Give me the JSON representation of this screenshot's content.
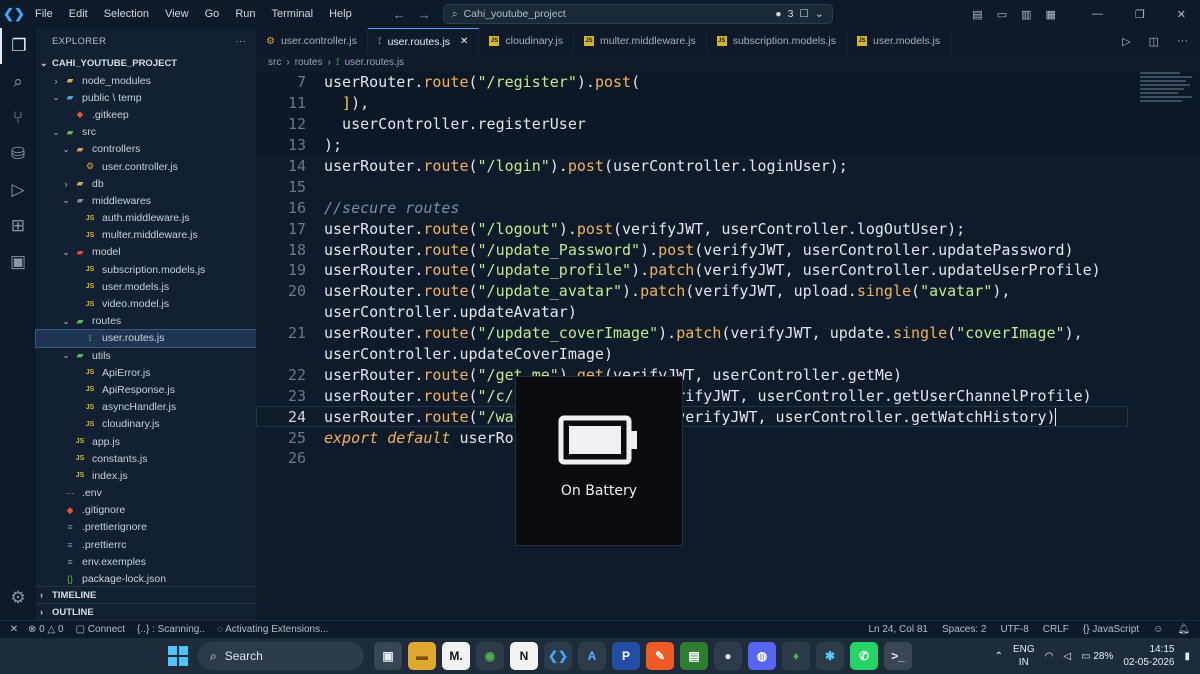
{
  "titlebar": {
    "menu": [
      "File",
      "Edit",
      "Selection",
      "View",
      "Go",
      "Run",
      "Terminal",
      "Help"
    ],
    "search_text": "Cahi_youtube_project",
    "badge_count": "3"
  },
  "sidebar": {
    "header": "EXPLORER",
    "project": "CAHI_YOUTUBE_PROJECT",
    "tree": [
      {
        "label": "node_modules",
        "depth": 1,
        "chev": "›",
        "icon": "folder",
        "color": "#d8a657"
      },
      {
        "label": "public \\ temp",
        "depth": 1,
        "chev": "⌄",
        "icon": "folder",
        "color": "#4fa3d9"
      },
      {
        "label": ".gitkeep",
        "depth": 2,
        "chev": "",
        "icon": "git",
        "color": "#e0533c"
      },
      {
        "label": "src",
        "depth": 1,
        "chev": "⌄",
        "icon": "folder",
        "color": "#5cb85c"
      },
      {
        "label": "controllers",
        "depth": 2,
        "chev": "⌄",
        "icon": "folder",
        "color": "#d8a657"
      },
      {
        "label": "user.controller.js",
        "depth": 3,
        "chev": "",
        "icon": "gear",
        "color": "#e0a03c"
      },
      {
        "label": "db",
        "depth": 2,
        "chev": "›",
        "icon": "folder",
        "color": "#d8a657"
      },
      {
        "label": "middlewares",
        "depth": 2,
        "chev": "⌄",
        "icon": "folder",
        "color": "#9b7cc2"
      },
      {
        "label": "auth.middleware.js",
        "depth": 3,
        "chev": "",
        "icon": "js",
        "color": "#d6b92a"
      },
      {
        "label": "multer.middleware.js",
        "depth": 3,
        "chev": "",
        "icon": "js",
        "color": "#d6b92a"
      },
      {
        "label": "model",
        "depth": 2,
        "chev": "⌄",
        "icon": "folder",
        "color": "#e0533c"
      },
      {
        "label": "subscription.models.js",
        "depth": 3,
        "chev": "",
        "icon": "js",
        "color": "#d6b92a"
      },
      {
        "label": "user.models.js",
        "depth": 3,
        "chev": "",
        "icon": "js",
        "color": "#d6b92a"
      },
      {
        "label": "video.model.js",
        "depth": 3,
        "chev": "",
        "icon": "js",
        "color": "#d6b92a"
      },
      {
        "label": "routes",
        "depth": 2,
        "chev": "⌄",
        "icon": "folder",
        "color": "#5cb85c"
      },
      {
        "label": "user.routes.js",
        "depth": 3,
        "chev": "",
        "icon": "route",
        "color": "#5cb85c",
        "selected": true
      },
      {
        "label": "utils",
        "depth": 2,
        "chev": "⌄",
        "icon": "folder",
        "color": "#5cb85c"
      },
      {
        "label": "ApiError.js",
        "depth": 3,
        "chev": "",
        "icon": "js",
        "color": "#d6b92a"
      },
      {
        "label": "ApiResponse.js",
        "depth": 3,
        "chev": "",
        "icon": "js",
        "color": "#d6b92a"
      },
      {
        "label": "asyncHandler.js",
        "depth": 3,
        "chev": "",
        "icon": "js",
        "color": "#d6b92a"
      },
      {
        "label": "cloudinary.js",
        "depth": 3,
        "chev": "",
        "icon": "js",
        "color": "#d6b92a"
      },
      {
        "label": "app.js",
        "depth": 2,
        "chev": "",
        "icon": "js",
        "color": "#d6b92a"
      },
      {
        "label": "constants.js",
        "depth": 2,
        "chev": "",
        "icon": "js",
        "color": "#d6b92a"
      },
      {
        "label": "index.js",
        "depth": 2,
        "chev": "",
        "icon": "js",
        "color": "#d6b92a"
      },
      {
        "label": ".env",
        "depth": 1,
        "chev": "",
        "icon": "env",
        "color": "#d8a657"
      },
      {
        "label": ".gitignore",
        "depth": 1,
        "chev": "",
        "icon": "git",
        "color": "#e0533c"
      },
      {
        "label": ".prettierignore",
        "depth": 1,
        "chev": "",
        "icon": "prettier",
        "color": "#5a9bcf"
      },
      {
        "label": ".prettierrc",
        "depth": 1,
        "chev": "",
        "icon": "prettier",
        "color": "#5a9bcf"
      },
      {
        "label": "env.exemples",
        "depth": 1,
        "chev": "",
        "icon": "file",
        "color": "#8a94a3"
      },
      {
        "label": "package-lock.json",
        "depth": 1,
        "chev": "",
        "icon": "json",
        "color": "#5cb85c"
      }
    ],
    "timeline": "TIMELINE",
    "outline": "OUTLINE"
  },
  "tabs": [
    {
      "label": "user.controller.js",
      "icon": "gear",
      "active": false
    },
    {
      "label": "user.routes.js",
      "icon": "route",
      "active": true
    },
    {
      "label": "cloudinary.js",
      "icon": "js",
      "active": false
    },
    {
      "label": "multer.middleware.js",
      "icon": "js",
      "active": false
    },
    {
      "label": "subscription.models.js",
      "icon": "js",
      "active": false
    },
    {
      "label": "user.models.js",
      "icon": "js",
      "active": false
    }
  ],
  "breadcrumb": [
    "src",
    "routes",
    "user.routes.js"
  ],
  "code_lines": [
    {
      "n": "7",
      "sticky": true,
      "tokens": [
        [
          "userRouter",
          "var"
        ],
        [
          ".",
          ""
        ],
        [
          "route",
          "meth"
        ],
        [
          "(",
          ""
        ],
        [
          "\"/register\"",
          "str"
        ],
        [
          ").",
          ""
        ],
        [
          "post",
          "meth"
        ],
        [
          "(",
          ""
        ]
      ]
    },
    {
      "n": "11",
      "sticky": true,
      "tokens": [
        [
          "  ]",
          "br"
        ],
        [
          "),",
          ""
        ]
      ]
    },
    {
      "n": "12",
      "sticky": true,
      "tokens": [
        [
          "  userController.registerUser",
          ""
        ]
      ]
    },
    {
      "n": "13",
      "sticky": true,
      "tokens": [
        [
          ");",
          ""
        ]
      ]
    },
    {
      "n": "14",
      "tokens": [
        [
          "userRouter",
          "var"
        ],
        [
          ".",
          ""
        ],
        [
          "route",
          "meth"
        ],
        [
          "(",
          ""
        ],
        [
          "\"/login\"",
          "str"
        ],
        [
          ").",
          ""
        ],
        [
          "post",
          "meth"
        ],
        [
          "(userController.loginUser);",
          ""
        ]
      ]
    },
    {
      "n": "15",
      "tokens": []
    },
    {
      "n": "16",
      "tokens": [
        [
          "//secure routes",
          "cmt"
        ]
      ]
    },
    {
      "n": "17",
      "tokens": [
        [
          "userRouter",
          "var"
        ],
        [
          ".",
          ""
        ],
        [
          "route",
          "meth"
        ],
        [
          "(",
          ""
        ],
        [
          "\"/logout\"",
          "str"
        ],
        [
          ").",
          ""
        ],
        [
          "post",
          "meth"
        ],
        [
          "(verifyJWT, userController.logOutUser);",
          ""
        ]
      ]
    },
    {
      "n": "18",
      "tokens": [
        [
          "userRouter",
          "var"
        ],
        [
          ".",
          ""
        ],
        [
          "route",
          "meth"
        ],
        [
          "(",
          ""
        ],
        [
          "\"/update_Password\"",
          "str"
        ],
        [
          ").",
          ""
        ],
        [
          "post",
          "meth"
        ],
        [
          "(verifyJWT, userController.updatePassword)",
          ""
        ]
      ]
    },
    {
      "n": "19",
      "tokens": [
        [
          "userRouter",
          "var"
        ],
        [
          ".",
          ""
        ],
        [
          "route",
          "meth"
        ],
        [
          "(",
          ""
        ],
        [
          "\"/update_profile\"",
          "str"
        ],
        [
          ").",
          ""
        ],
        [
          "patch",
          "meth"
        ],
        [
          "(verifyJWT, userController.updateUserProfile)",
          ""
        ]
      ]
    },
    {
      "n": "20",
      "tokens": [
        [
          "userRouter",
          "var"
        ],
        [
          ".",
          ""
        ],
        [
          "route",
          "meth"
        ],
        [
          "(",
          ""
        ],
        [
          "\"/update_avatar\"",
          "str"
        ],
        [
          ").",
          ""
        ],
        [
          "patch",
          "meth"
        ],
        [
          "(verifyJWT, upload.",
          ""
        ],
        [
          "single",
          "meth"
        ],
        [
          "(",
          ""
        ],
        [
          "\"avatar\"",
          "str"
        ],
        [
          "),",
          ""
        ]
      ]
    },
    {
      "n": "",
      "tokens": [
        [
          "userController.updateAvatar)",
          ""
        ]
      ]
    },
    {
      "n": "21",
      "tokens": [
        [
          "userRouter",
          "var"
        ],
        [
          ".",
          ""
        ],
        [
          "route",
          "meth"
        ],
        [
          "(",
          ""
        ],
        [
          "\"/update_coverImage\"",
          "str"
        ],
        [
          ").",
          ""
        ],
        [
          "patch",
          "meth"
        ],
        [
          "(verifyJWT, update.",
          ""
        ],
        [
          "single",
          "meth"
        ],
        [
          "(",
          ""
        ],
        [
          "\"coverImage\"",
          "str"
        ],
        [
          "),",
          ""
        ]
      ]
    },
    {
      "n": "",
      "tokens": [
        [
          "userController.updateCoverImage)",
          ""
        ]
      ]
    },
    {
      "n": "22",
      "tokens": [
        [
          "userRouter",
          "var"
        ],
        [
          ".",
          ""
        ],
        [
          "route",
          "meth"
        ],
        [
          "(",
          ""
        ],
        [
          "\"/get_me\"",
          "str"
        ],
        [
          ").",
          ""
        ],
        [
          "get",
          "meth"
        ],
        [
          "(verifyJWT, userController.getMe)",
          ""
        ]
      ]
    },
    {
      "n": "23",
      "tokens": [
        [
          "userRouter",
          "var"
        ],
        [
          ".",
          ""
        ],
        [
          "route",
          "meth"
        ],
        [
          "(",
          ""
        ],
        [
          "\"/c/:username\"",
          "str"
        ],
        [
          ").",
          ""
        ],
        [
          "get",
          "meth"
        ],
        [
          "(verifyJWT, userController.getUserChannelProfile)",
          ""
        ]
      ]
    },
    {
      "n": "24",
      "cur": true,
      "tokens": [
        [
          "userRouter",
          "var"
        ],
        [
          ".",
          ""
        ],
        [
          "route",
          "meth"
        ],
        [
          "(",
          ""
        ],
        [
          "\"/watch_history\"",
          "str"
        ],
        [
          ").",
          ""
        ],
        [
          "get",
          "meth"
        ],
        [
          "(verifyJWT, userController.getWatchHistory)",
          ""
        ]
      ]
    },
    {
      "n": "25",
      "tokens": [
        [
          "export default",
          "kw"
        ],
        [
          " userRouter;",
          ""
        ]
      ]
    },
    {
      "n": "26",
      "tokens": []
    }
  ],
  "overlay": {
    "label": "On Battery"
  },
  "statusbar": {
    "errors": "0",
    "warnings": "0",
    "connect": "Connect",
    "scanning": "{..} : Scanning..",
    "activating": "Activating Extensions...",
    "position": "Ln 24, Col 81",
    "spaces": "Spaces: 2",
    "encoding": "UTF-8",
    "eol": "CRLF",
    "language": "JavaScript"
  },
  "taskbar": {
    "search": "Search",
    "apps": [
      {
        "name": "task-view",
        "glyph": "▣",
        "bg": "#3a4656",
        "fg": "#e7ebf0"
      },
      {
        "name": "file-explorer",
        "glyph": "▬",
        "bg": "#e0a82e",
        "fg": "#7a4f0e"
      },
      {
        "name": "medium",
        "glyph": "M.",
        "bg": "#f2f2f2",
        "fg": "#111111"
      },
      {
        "name": "chrome",
        "glyph": "◉",
        "bg": "#2c3a4a",
        "fg": "#4caf50"
      },
      {
        "name": "notion",
        "glyph": "N",
        "bg": "#f2f2f2",
        "fg": "#111111"
      },
      {
        "name": "vscode",
        "glyph": "❮❯",
        "bg": "#2c3a4a",
        "fg": "#3ea6ff"
      },
      {
        "name": "app-a",
        "glyph": "A",
        "bg": "#2c3a4a",
        "fg": "#5cb0ff"
      },
      {
        "name": "app-p",
        "glyph": "P",
        "bg": "#1f4ea3",
        "fg": "#ffffff"
      },
      {
        "name": "postman",
        "glyph": "✎",
        "bg": "#ef5b25",
        "fg": "#ffffff"
      },
      {
        "name": "terminal-green",
        "glyph": "▤",
        "bg": "#2e7d32",
        "fg": "#ffffff"
      },
      {
        "name": "github",
        "glyph": "●",
        "bg": "#2c3a4a",
        "fg": "#e7ebf0"
      },
      {
        "name": "discord",
        "glyph": "◍",
        "bg": "#5865f2",
        "fg": "#ffffff"
      },
      {
        "name": "mongodb",
        "glyph": "♦",
        "bg": "#2c3a4a",
        "fg": "#4caf50"
      },
      {
        "name": "app-k",
        "glyph": "✱",
        "bg": "#2c3a4a",
        "fg": "#4fd1ff"
      },
      {
        "name": "whatsapp",
        "glyph": "✆",
        "bg": "#25d366",
        "fg": "#ffffff"
      },
      {
        "name": "terminal",
        "glyph": ">_",
        "bg": "#3a4656",
        "fg": "#e7ebf0"
      }
    ],
    "lang_top": "ENG",
    "lang_bottom": "IN",
    "battery": "28%",
    "time": "14:15",
    "date": "02-05-2026"
  },
  "colors": {
    "accent": "#3ea6ff",
    "string": "#c3e88d",
    "method": "#f0b35a"
  }
}
